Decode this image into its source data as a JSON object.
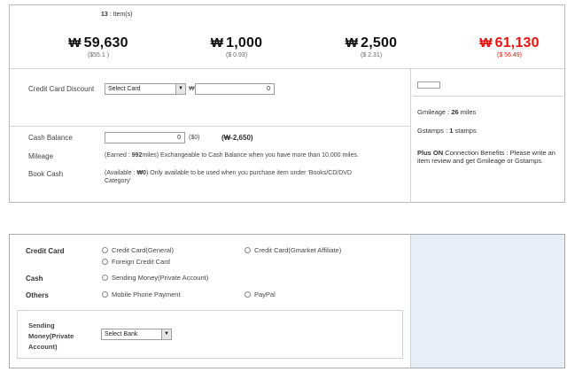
{
  "summary": {
    "items_count_number": "13",
    "items_count_suffix": " : Item(s)",
    "amounts": [
      {
        "currency": "₩",
        "value": "59,630",
        "usd": "($55.1 )"
      },
      {
        "currency": "₩",
        "value": "1,000",
        "usd": "($ 0.93)"
      },
      {
        "currency": "₩",
        "value": "2,500",
        "usd": "($ 2.31)"
      },
      {
        "currency": "₩",
        "value": "61,130",
        "usd": "($ 56.49)"
      }
    ],
    "credit_card_discount": {
      "label": "Credit Card Discount",
      "select_value": "Select Card",
      "currency_symbol": "₩",
      "input_value": "0"
    },
    "cash_balance": {
      "label": "Cash Balance",
      "input_value": "0",
      "usd": "($0)",
      "balance": "(₩-2,650)"
    },
    "mileage": {
      "label": "Mileage",
      "earned_prefix": "(Earned : ",
      "earned_value": "992",
      "earned_suffix": "miles) Exchangeable to Cash Balance when you have more than 10,000 miles."
    },
    "book_cash": {
      "label": "Book Cash",
      "line1_prefix": "(Available : ",
      "available_value": "₩0",
      "line1_suffix": ") Only available to be used when you purchase item under 'Books/CD/DVD",
      "line2": "Category'"
    },
    "side": {
      "gmileage_prefix": "Gmileage : ",
      "gmileage_value": "26",
      "gmileage_suffix": " miles",
      "gstamps_prefix": "Gstamps : ",
      "gstamps_value": "1",
      "gstamps_suffix": " stamps",
      "plus_on_bold": "Plus ON",
      "plus_on_text": " Connection Benefits : Please write an item review and get Gmileage or Gstamps."
    }
  },
  "payment": {
    "credit_card_label": "Credit Card",
    "cash_label": "Cash",
    "others_label": "Others",
    "options": {
      "credit_general": "Credit Card(General)",
      "credit_gmarket": "Credit Card(Gmarket Affiliate)",
      "foreign_credit": "Foreign Credit Card",
      "sending_money": "Sending Money(Private Account)",
      "mobile_phone": "Mobile Phone Payment",
      "paypal": "PayPal"
    },
    "bank_section_label": "Sending Money(Private Account)",
    "bank_select_value": "Select Bank"
  },
  "icons": {
    "dropdown": "chevron-down-icon",
    "radio": "radio-circle-icon"
  },
  "colors": {
    "total_red": "#e8120c",
    "panel_blue": "#e8eef8"
  }
}
